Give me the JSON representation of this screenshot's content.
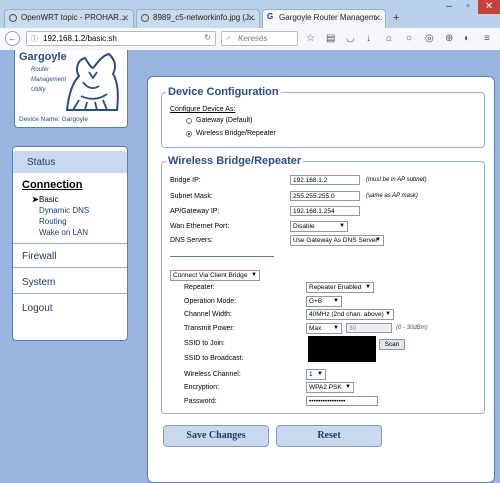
{
  "browser": {
    "tabs": [
      {
        "label": "OpenWRT topic - PROHAR..."
      },
      {
        "label": "8989_c5-networkinfo.jpg (J..."
      },
      {
        "label": "Gargoyle Router Managem..."
      }
    ],
    "new_tab": "+",
    "url": "192.168.1.2/basic.sh",
    "search_placeholder": "Keresés"
  },
  "logo": {
    "title": "Gargoyle",
    "line1": "Router",
    "line2": "Management",
    "line3": "Utility",
    "device_name": "Device Name: Gargoyle"
  },
  "menu": {
    "status": "Status",
    "connection": "Connection",
    "sub": [
      "Basic",
      "Dynamic DNS",
      "Routing",
      "Wake on LAN"
    ],
    "firewall": "Firewall",
    "system": "System",
    "logout": "Logout"
  },
  "device_config": {
    "legend": "Device Configuration",
    "configure_as": "Configure Device As:",
    "options": [
      "Gateway (Default)",
      "Wireless Bridge/Repeater"
    ],
    "selected": 1
  },
  "bridge": {
    "legend": "Wireless Bridge/Repeater",
    "bridge_ip_label": "Bridge IP:",
    "bridge_ip": "192.168.1.2",
    "bridge_ip_note": "(must be in AP subnet)",
    "subnet_label": "Subnet Mask:",
    "subnet": "255.255.255.0",
    "subnet_note": "(same as AP mask)",
    "gateway_label": "AP/Gateway IP:",
    "gateway": "192.168.1.254",
    "wan_label": "Wan Ethernet Port:",
    "wan": "Disable",
    "dns_label": "DNS Servers:",
    "dns": "Use Gateway As DNS Server",
    "connect_via": "Connect Via Client Bridge",
    "repeater_label": "Repeater:",
    "repeater": "Repeater Enabled",
    "mode_label": "Operation Mode:",
    "mode": "G+B",
    "width_label": "Channel Width:",
    "width": "40MHz (2nd chan. above)",
    "power_label": "Transmit Power:",
    "power": "Max",
    "power_value": "30",
    "power_note": "(0 - 30dBm)",
    "ssid_join_label": "SSID to Join:",
    "scan": "Scan",
    "ssid_broadcast_label": "SSID to Broadcast:",
    "channel_label": "Wireless Channel:",
    "channel": "1",
    "encryption_label": "Encryption:",
    "encryption": "WPA2 PSK",
    "password_label": "Password:",
    "password": "••••••••••••••••"
  },
  "buttons": {
    "save": "Save Changes",
    "reset": "Reset"
  }
}
